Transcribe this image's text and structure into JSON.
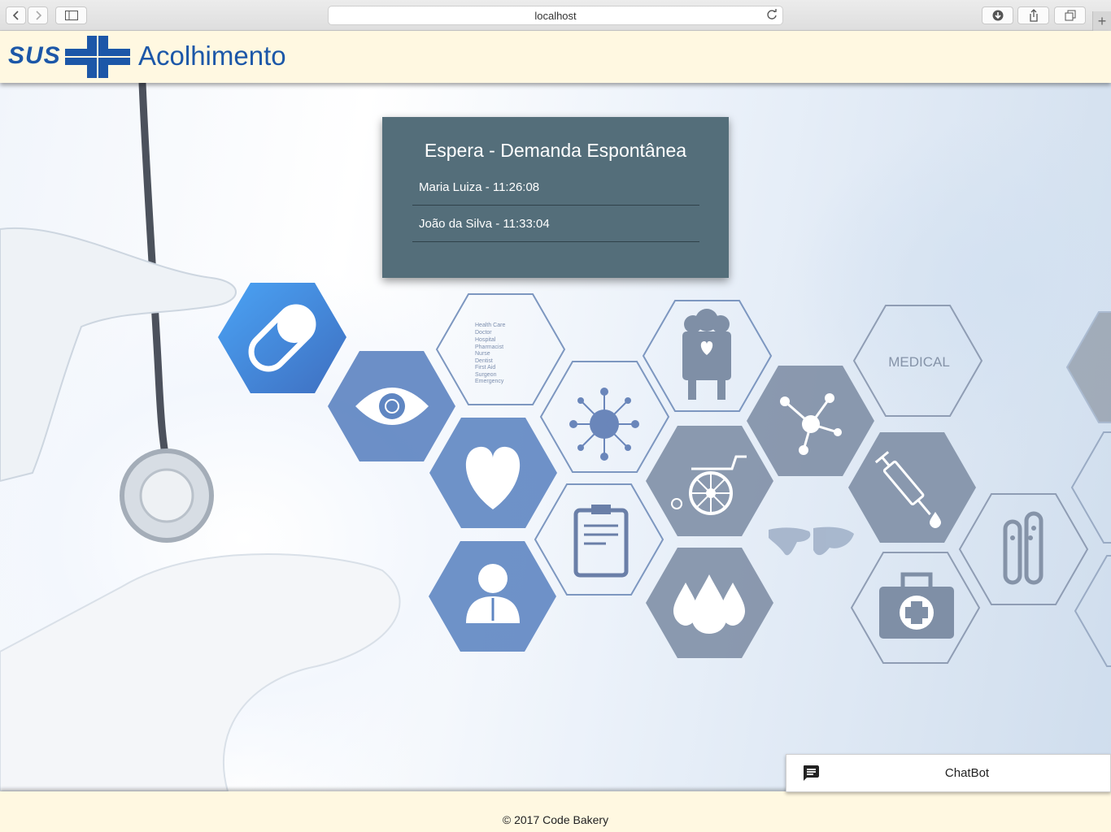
{
  "browser": {
    "url": "localhost"
  },
  "header": {
    "logo_text": "SUS",
    "app_title": "Acolhimento"
  },
  "hero": {
    "hex_labels": {
      "medical": "MEDICAL",
      "care_list": [
        "Health Care",
        "Doctor",
        "Hospital",
        "Pharmacist",
        "Nurse",
        "Dentist",
        "First Aid",
        "Surgeon",
        "Emergency"
      ]
    }
  },
  "queue_card": {
    "title": "Espera - Demanda Espontânea",
    "entries": [
      {
        "text": "Maria Luiza - 11:26:08"
      },
      {
        "text": "João da Silva - 11:33:04"
      }
    ]
  },
  "chatbot": {
    "icon": "chat-bubble-icon",
    "label": "ChatBot"
  },
  "footer": {
    "copyright": "© 2017 Code Bakery"
  },
  "colors": {
    "header_bg": "#fff8e1",
    "brand_blue": "#1c57a8",
    "card_bg": "#546e7a",
    "hex_blue": "#5f86c2",
    "hex_grey": "#7f8fa6"
  }
}
